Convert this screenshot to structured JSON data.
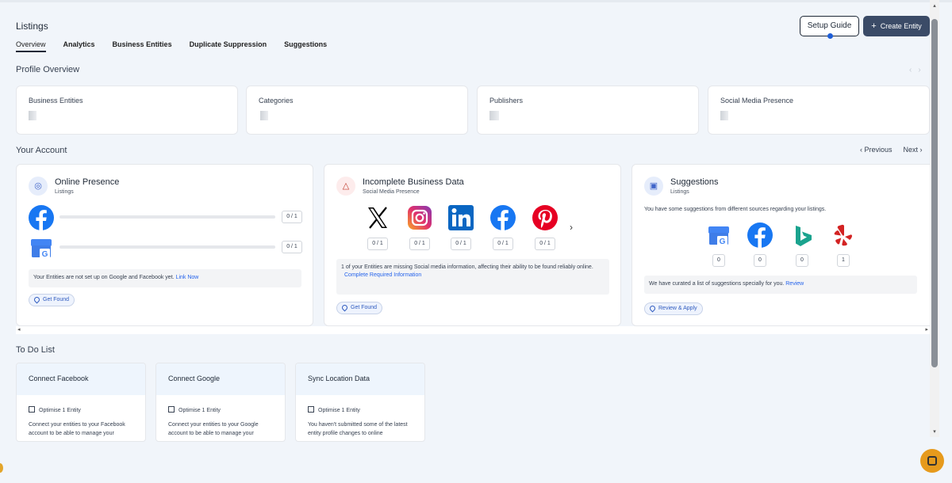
{
  "header": {
    "title": "Listings",
    "setup_guide": "Setup Guide",
    "create_entity": "Create Entity"
  },
  "tabs": [
    {
      "label": "Overview"
    },
    {
      "label": "Analytics"
    },
    {
      "label": "Business Entities"
    },
    {
      "label": "Duplicate Suppression"
    },
    {
      "label": "Suggestions"
    }
  ],
  "profile_overview": {
    "title": "Profile Overview",
    "stats": [
      {
        "label": "Business Entities"
      },
      {
        "label": "Categories"
      },
      {
        "label": "Publishers"
      },
      {
        "label": "Social Media Presence"
      }
    ]
  },
  "account": {
    "title": "Your Account",
    "previous": "Previous",
    "next": "Next",
    "online_presence": {
      "title": "Online Presence",
      "subtitle": "Listings",
      "rows": [
        {
          "icon": "facebook-icon",
          "count": "0 / 1"
        },
        {
          "icon": "google-business-icon",
          "count": "0 / 1"
        }
      ],
      "note": "Your Entities are not set up on Google and Facebook yet.",
      "note_link": "Link Now",
      "action": "Get Found"
    },
    "incomplete_data": {
      "title": "Incomplete Business Data",
      "subtitle": "Social Media Presence",
      "networks": [
        {
          "icon": "x-icon",
          "count": "0 / 1"
        },
        {
          "icon": "instagram-icon",
          "count": "0 / 1"
        },
        {
          "icon": "linkedin-icon",
          "count": "0 / 1"
        },
        {
          "icon": "facebook-icon",
          "count": "0 / 1"
        },
        {
          "icon": "pinterest-icon",
          "count": "0 / 1"
        }
      ],
      "note": "1 of your Entities are missing Social media information, affecting their ability to be found reliably online.",
      "note_link": "Complete Required Information",
      "action": "Get Found"
    },
    "suggestions": {
      "title": "Suggestions",
      "subtitle": "Listings",
      "intro": "You have some suggestions from different sources regarding your listings.",
      "sources": [
        {
          "icon": "google-business-icon",
          "count": "0"
        },
        {
          "icon": "facebook-icon",
          "count": "0"
        },
        {
          "icon": "bing-icon",
          "count": "0"
        },
        {
          "icon": "yelp-icon",
          "count": "1"
        }
      ],
      "note": "We have curated a list of suggestions specially for you.",
      "note_link": "Review",
      "action": "Review & Apply"
    }
  },
  "todo": {
    "title": "To Do List",
    "items": [
      {
        "title": "Connect Facebook",
        "optimise": "Optimise 1 Entity",
        "desc": "Connect your entities to your Facebook account to be able to manage your"
      },
      {
        "title": "Connect Google",
        "optimise": "Optimise 1 Entity",
        "desc": "Connect your entities to your Google account to be able to manage your"
      },
      {
        "title": "Sync Location Data",
        "optimise": "Optimise 1 Entity",
        "desc": "You haven't submitted some of the latest entity profile changes to online"
      }
    ]
  },
  "colors": {
    "primary_button": "#3b4b67",
    "link": "#2563eb",
    "accent_dot": "#1e5ed7",
    "chat": "#e69a1c"
  }
}
